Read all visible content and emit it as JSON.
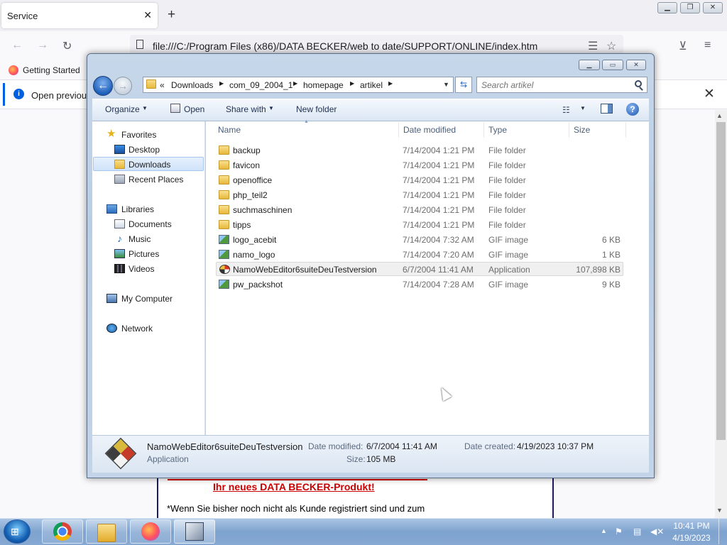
{
  "browser": {
    "tab_title": "Service",
    "tab_close_icon": "close-icon",
    "url": "file:///C:/Program Files (x86)/DATA BECKER/web to date/SUPPORT/ONLINE/index.htm",
    "bookmark": "Getting Started",
    "notice_text": "Open previous"
  },
  "page": {
    "red_link": "Ihr neues DATA BECKER-Produkt!",
    "body_text": "*Wenn Sie bisher noch nicht als Kunde registriert sind und zum"
  },
  "explorer": {
    "breadcrumb": {
      "overflow": "«",
      "items": [
        "Downloads",
        "com_09_2004_1",
        "homepage",
        "artikel"
      ]
    },
    "search_placeholder": "Search artikel",
    "toolbar": {
      "organize": "Organize",
      "open": "Open",
      "share_with": "Share with",
      "new_folder": "New folder"
    },
    "nav": {
      "favorites": "Favorites",
      "desktop": "Desktop",
      "downloads": "Downloads",
      "recent_places": "Recent Places",
      "libraries": "Libraries",
      "documents": "Documents",
      "music": "Music",
      "pictures": "Pictures",
      "videos": "Videos",
      "my_computer": "My Computer",
      "network": "Network"
    },
    "columns": {
      "name": "Name",
      "date_modified": "Date modified",
      "type": "Type",
      "size": "Size"
    },
    "files": [
      {
        "name": "backup",
        "date": "7/14/2004 1:21 PM",
        "type": "File folder",
        "size": "",
        "icon": "folder-icon"
      },
      {
        "name": "favicon",
        "date": "7/14/2004 1:21 PM",
        "type": "File folder",
        "size": "",
        "icon": "folder-icon"
      },
      {
        "name": "openoffice",
        "date": "7/14/2004 1:21 PM",
        "type": "File folder",
        "size": "",
        "icon": "folder-icon"
      },
      {
        "name": "php_teil2",
        "date": "7/14/2004 1:21 PM",
        "type": "File folder",
        "size": "",
        "icon": "folder-icon"
      },
      {
        "name": "suchmaschinen",
        "date": "7/14/2004 1:21 PM",
        "type": "File folder",
        "size": "",
        "icon": "folder-icon"
      },
      {
        "name": "tipps",
        "date": "7/14/2004 1:21 PM",
        "type": "File folder",
        "size": "",
        "icon": "folder-icon"
      },
      {
        "name": "logo_acebit",
        "date": "7/14/2004 7:32 AM",
        "type": "GIF image",
        "size": "6 KB",
        "icon": "gif-image-icon"
      },
      {
        "name": "namo_logo",
        "date": "7/14/2004 7:20 AM",
        "type": "GIF image",
        "size": "1 KB",
        "icon": "gif-image-icon"
      },
      {
        "name": "NamoWebEditor6suiteDeuTestversion",
        "date": "6/7/2004 11:41 AM",
        "type": "Application",
        "size": "107,898 KB",
        "icon": "application-icon"
      },
      {
        "name": "pw_packshot",
        "date": "7/14/2004 7:28 AM",
        "type": "GIF image",
        "size": "9 KB",
        "icon": "gif-image-icon"
      }
    ],
    "details": {
      "name": "NamoWebEditor6suiteDeuTestversion",
      "type": "Application",
      "date_modified_label": "Date modified:",
      "date_modified": "6/7/2004 11:41 AM",
      "size_label": "Size:",
      "size": "105 MB",
      "date_created_label": "Date created:",
      "date_created": "4/19/2023 10:37 PM"
    }
  },
  "taskbar": {
    "time": "10:41 PM",
    "date": "4/19/2023",
    "apps": [
      "chrome-icon",
      "explorer-icon",
      "firefox-icon",
      "namo-webeditor-icon"
    ]
  },
  "colors": {
    "taskbar": "#86a8d2",
    "link_red": "#cc0000",
    "firefox_blue": "#0060df"
  }
}
